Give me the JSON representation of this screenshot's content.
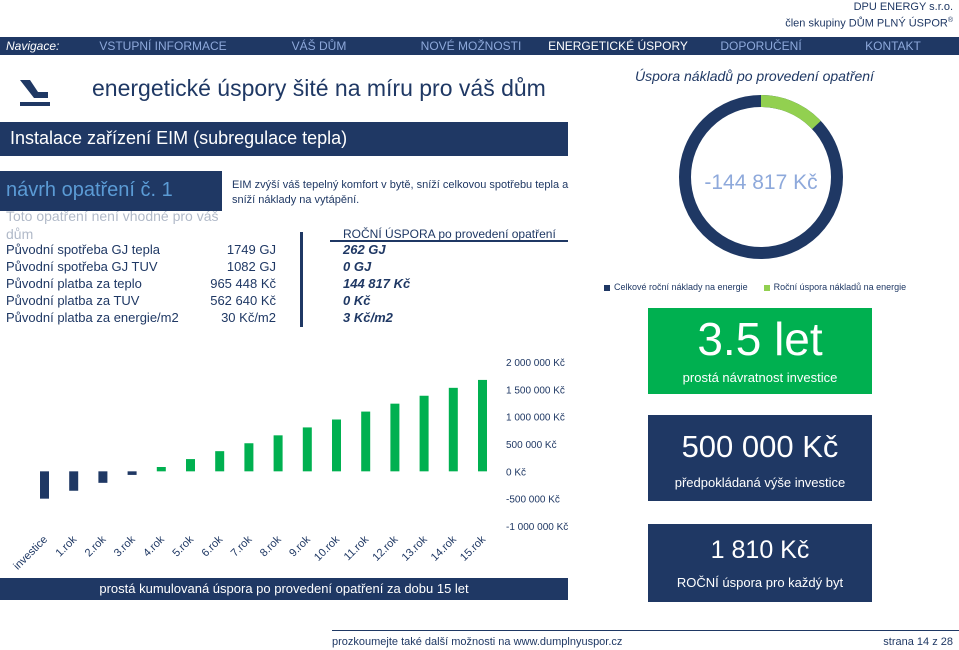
{
  "company": {
    "name": "DPU ENERGY s.r.o.",
    "group": "člen skupiny DŮM PLNÝ ÚSPOR",
    "registered": "®"
  },
  "nav": {
    "label": "Navigace:",
    "items": [
      "VSTUPNÍ INFORMACE",
      "VÁŠ DŮM",
      "NOVÉ MOŽNOSTI",
      "ENERGETICKÉ ÚSPORY",
      "DOPORUČENÍ",
      "KONTAKT"
    ],
    "active_index": 3
  },
  "main_title": "energetické úspory šité na míru pro váš dům",
  "right_title": "Úspora nákladů po provedení opatření",
  "measure_title": "Instalace zařízení EIM (subregulace tepla)",
  "proposal_label": "návrh opatření č. 1",
  "unsuitable_text": "Toto opatření není vhodné pro váš dům",
  "description": "EIM zvýší váš tepelný komfort v bytě, sníží celkovou spotřebu tepla a sníží náklady na vytápění.",
  "savings_header": "ROČNÍ ÚSPORA po provedení opatření",
  "rows": [
    {
      "label": "Původní spotřeba GJ tepla",
      "value": "1749 GJ",
      "saving": "262 GJ"
    },
    {
      "label": "Původní spotřeba GJ TUV",
      "value": "1082 GJ",
      "saving": "0 GJ"
    },
    {
      "label": "Původní platba za teplo",
      "value": "965 448 Kč",
      "saving": "144 817 Kč"
    },
    {
      "label": "Původní platba za TUV",
      "value": "562 640 Kč",
      "saving": "0 Kč"
    },
    {
      "label": "Původní platba za energie/m2",
      "value": "30 Kč/m2",
      "saving": "3 Kč/m2"
    }
  ],
  "chart_footer": "prostá kumulovaná úspora po provedení opatření za dobu 15 let",
  "donut": {
    "label": "-144 817 Kč",
    "share_savings": 0.13,
    "colors": {
      "costs": "#1f3864",
      "savings": "#92d050"
    }
  },
  "legend": {
    "costs": "Celkové roční náklady na energie",
    "savings": "Roční úspora nákladů na energie"
  },
  "kpis": [
    {
      "big": "3.5 let",
      "small": "prostá návratnost investice"
    },
    {
      "big": "500 000 Kč",
      "small": "předpokládaná výše investice"
    },
    {
      "big": "1 810 Kč",
      "small": "ROČNÍ úspora pro každý byt"
    }
  ],
  "bottom_link": "prozkoumejte také další možnosti na www.dumplnyuspor.cz",
  "page": "strana 14 z 28",
  "chart_data": {
    "type": "bar",
    "categories": [
      "investice",
      "1.rok",
      "2.rok",
      "3.rok",
      "4.rok",
      "5.rok",
      "6.rok",
      "7.rok",
      "8.rok",
      "9.rok",
      "10.rok",
      "11.rok",
      "12.rok",
      "13.rok",
      "14.rok",
      "15.rok"
    ],
    "values": [
      -500000,
      -355183,
      -210366,
      -65549,
      79268,
      224085,
      368902,
      513719,
      658536,
      803353,
      948170,
      1092987,
      1237804,
      1382621,
      1527438,
      1672255
    ],
    "yticks": [
      "2 000 000 Kč",
      "1 500 000 Kč",
      "1 000 000 Kč",
      "500 000 Kč",
      "0 Kč",
      "-500 000 Kč",
      "-1 000 000 Kč"
    ],
    "ylim": [
      -1000000,
      2000000
    ],
    "colors": {
      "negative": "#1f3864",
      "positive": "#00b050"
    }
  }
}
